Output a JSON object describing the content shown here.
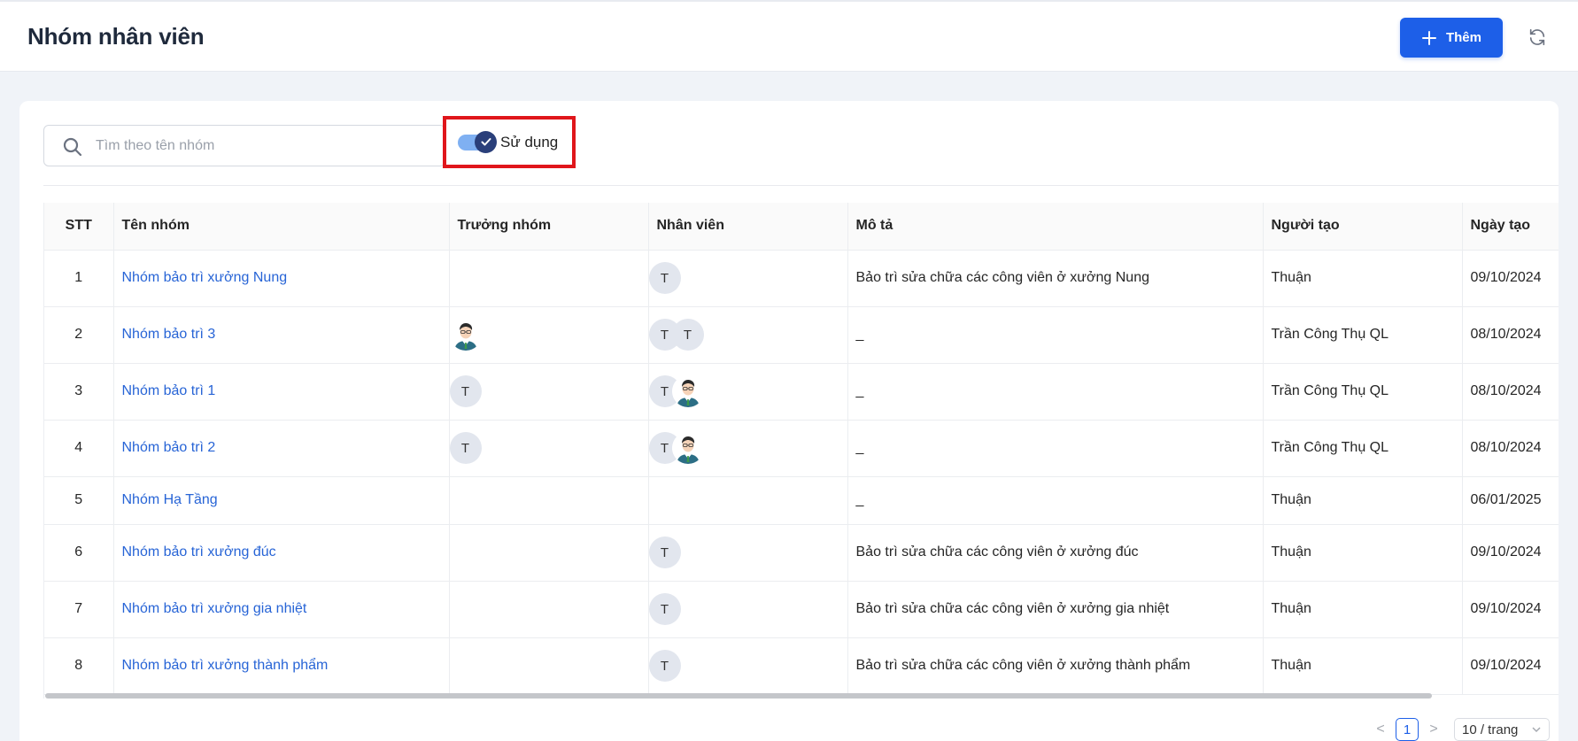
{
  "header": {
    "title": "Nhóm nhân viên",
    "add_label": "Thêm"
  },
  "filters": {
    "search_placeholder": "Tìm theo tên nhóm",
    "toggle_label": "Sử dụng",
    "toggle_on": true
  },
  "table": {
    "columns": [
      "STT",
      "Tên nhóm",
      "Trưởng nhóm",
      "Nhân viên",
      "Mô tả",
      "Người tạo",
      "Ngày tạo"
    ],
    "rows": [
      {
        "stt": "1",
        "name": "Nhóm bảo trì xưởng Nung",
        "leader": [],
        "members": [
          "T"
        ],
        "desc": "Bảo trì sửa chữa các công viên ở xưởng Nung",
        "creator": "Thuận",
        "date": "09/10/2024"
      },
      {
        "stt": "2",
        "name": "Nhóm bảo trì 3",
        "leader": [
          "photo"
        ],
        "members": [
          "T",
          "T"
        ],
        "desc": "_",
        "creator": "Trần Công Thụ QL",
        "date": "08/10/2024"
      },
      {
        "stt": "3",
        "name": "Nhóm bảo trì 1",
        "leader": [
          "T"
        ],
        "members": [
          "T",
          "photo"
        ],
        "desc": "_",
        "creator": "Trần Công Thụ QL",
        "date": "08/10/2024"
      },
      {
        "stt": "4",
        "name": "Nhóm bảo trì 2",
        "leader": [
          "T"
        ],
        "members": [
          "T",
          "photo"
        ],
        "desc": "_",
        "creator": "Trần Công Thụ QL",
        "date": "08/10/2024"
      },
      {
        "stt": "5",
        "name": "Nhóm Hạ Tầng",
        "leader": [],
        "members": [],
        "desc": "_",
        "creator": "Thuận",
        "date": "06/01/2025"
      },
      {
        "stt": "6",
        "name": "Nhóm bảo trì xưởng đúc",
        "leader": [],
        "members": [
          "T"
        ],
        "desc": "Bảo trì sửa chữa các công viên ở xưởng đúc",
        "creator": "Thuận",
        "date": "09/10/2024"
      },
      {
        "stt": "7",
        "name": "Nhóm bảo trì xưởng gia nhiệt",
        "leader": [],
        "members": [
          "T"
        ],
        "desc": "Bảo trì sửa chữa các công viên ở xưởng gia nhiệt",
        "creator": "Thuận",
        "date": "09/10/2024"
      },
      {
        "stt": "8",
        "name": "Nhóm bảo trì xưởng thành phẩm",
        "leader": [],
        "members": [
          "T"
        ],
        "desc": "Bảo trì sửa chữa các công viên ở xưởng thành phẩm",
        "creator": "Thuận",
        "date": "09/10/2024"
      }
    ]
  },
  "pagination": {
    "prev": "<",
    "current": "1",
    "next": ">",
    "page_size": "10 / trang"
  },
  "colors": {
    "primary": "#1d5fe8",
    "link": "#2764d6",
    "highlight_border": "#e0161b"
  },
  "icons": {
    "add": "plus-icon",
    "refresh": "refresh-icon",
    "search": "search-icon",
    "toggle": "check-icon",
    "size_select": "chevron-down-icon"
  }
}
